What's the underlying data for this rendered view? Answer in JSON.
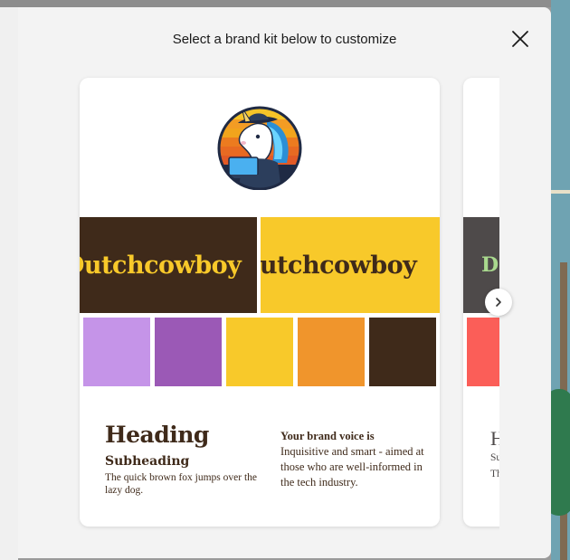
{
  "modal": {
    "title": "Select a brand kit below to customize",
    "close_icon": "close-icon",
    "next_icon": "chevron-right-icon"
  },
  "brand_kits": [
    {
      "logo": "unicorn-cowboy-laptop-logo",
      "banner_text": "Dutchcowboy",
      "palette": [
        "#3f2a1a",
        "#f8c92a",
        "#c594e8",
        "#9b59b6",
        "#f8c92a",
        "#f0952c",
        "#3f2a1a"
      ],
      "heading": "Heading",
      "subheading": "Subheading",
      "body": "The quick brown fox jumps over the lazy dog.",
      "voice_title": "Your brand voice is",
      "voice_text": "Inquisitive and smart - aimed at those who are well-informed in the tech industry."
    },
    {
      "banner_text": "D",
      "palette": [
        "#4e4a4a",
        "#fb5e58",
        "#a9d98e"
      ],
      "heading": "H",
      "subheading": "Su",
      "body": "Th ov"
    }
  ]
}
